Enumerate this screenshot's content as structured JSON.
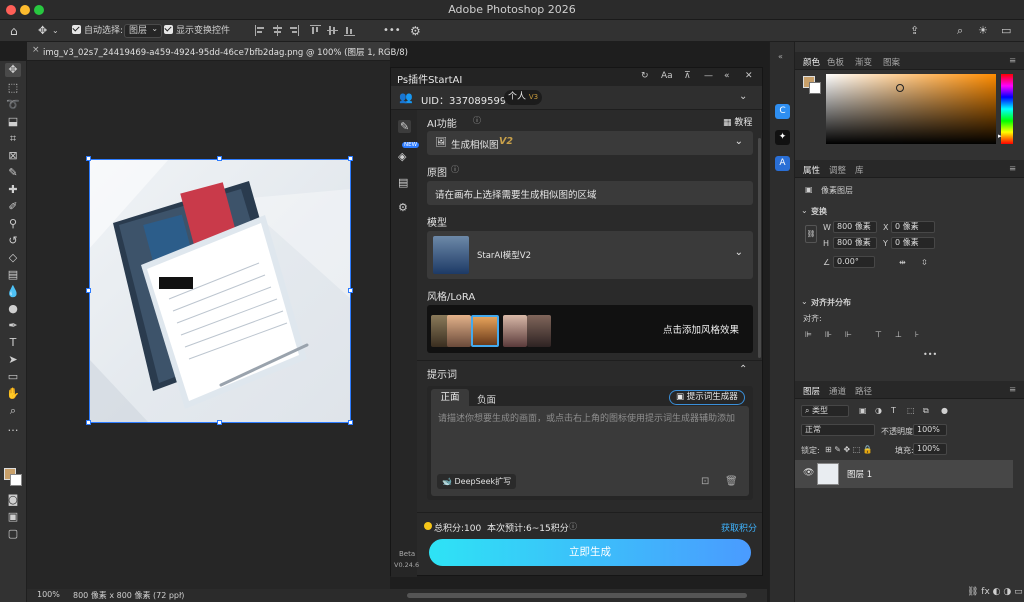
{
  "app": {
    "window_title": "Adobe Photoshop 2026",
    "accent": "#2d7cff"
  },
  "options_bar": {
    "auto_select_label": "自动选择:",
    "auto_select_value": "图层",
    "show_transform_label": "显示变换控件",
    "more_label": "•••"
  },
  "document": {
    "tab_title": "img_v3_02s7_24419469-a459-4924-95dd-46ce7bfb2dag.png @ 100% (图层 1, RGB/8)",
    "status_zoom": "100%",
    "status_size": "800 像素 x 800 像素 (72 ppi)"
  },
  "plugin": {
    "title": "Ps插件StartAI",
    "header_icons": [
      "refresh-icon",
      "font-icon",
      "pin-icon",
      "minimize-icon",
      "collapse-icon",
      "close-icon"
    ],
    "aa_label": "Aa",
    "uid_label": "UID：3370895991",
    "plan_label": "个人",
    "plan_badge": "V3",
    "sidebar_new_badge": "NEW",
    "ai_function_label": "AI功能",
    "tutorial_label": "教程",
    "function_value": "生成相似图",
    "function_version": "V2",
    "source_label": "原图",
    "source_hint": "请在画布上选择需要生成相似图的区域",
    "model_label": "模型",
    "model_value": "StarAI模型V2",
    "style_label": "风格/LoRA",
    "style_add_label": "点击添加风格效果",
    "prompt_section_label": "提示词",
    "prompt_tab_positive": "正面",
    "prompt_tab_negative": "负面",
    "prompt_generator_label": "提示词生成器",
    "prompt_placeholder": "请描述你想要生成的画面，或点击右上角的图标使用提示词生成器辅助添加",
    "deepseek_label": "DeepSeek扩写",
    "points_total": "总积分:100",
    "points_estimate": "本次预计:6~15积分",
    "get_points_label": "获取积分",
    "generate_label": "立即生成",
    "beta_label": "Beta",
    "version_label": "V0.24.6",
    "gradient_start": "#2ee3f5",
    "gradient_end": "#4a9bff"
  },
  "color_panel": {
    "tabs": [
      "颜色",
      "色板",
      "渐变",
      "图案"
    ],
    "foreground": "#c8a06a"
  },
  "properties_panel": {
    "tabs": [
      "属性",
      "调整",
      "库"
    ],
    "layer_type": "像素图层",
    "transform_label": "变换",
    "w_label": "W",
    "w_value": "800 像素",
    "h_label": "H",
    "h_value": "800 像素",
    "x_label": "X",
    "x_value": "0 像素",
    "y_label": "Y",
    "y_value": "0 像素",
    "angle_value": "0.00°",
    "align_label": "对齐并分布",
    "align_sub": "对齐:"
  },
  "layers_panel": {
    "tabs": [
      "图层",
      "通道",
      "路径"
    ],
    "filter_label": "类型",
    "blend_mode": "正常",
    "opacity_label": "不透明度:",
    "opacity_value": "100%",
    "lock_label": "锁定:",
    "fill_label": "填充:",
    "fill_value": "100%",
    "layer_name": "图层 1"
  }
}
